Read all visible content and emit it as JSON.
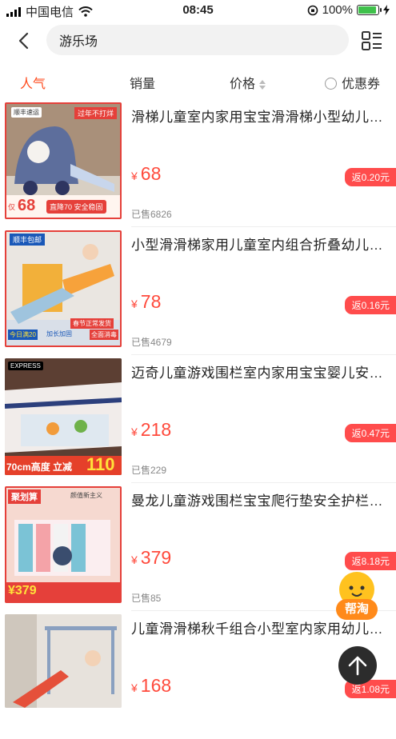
{
  "status_bar": {
    "carrier": "中国电信",
    "time": "08:45",
    "battery_percent": 100,
    "battery_label": "100%"
  },
  "search": {
    "query": "游乐场"
  },
  "sort_tabs": {
    "popular": "人气",
    "sales": "销量",
    "price": "价格",
    "coupon": "优惠券",
    "active": "popular"
  },
  "icons": {
    "back": "chevron-left-icon",
    "list_toggle": "list-grid-toggle-icon",
    "price_sort": "sort-arrows-icon",
    "back_to_top": "arrow-up-icon"
  },
  "colors": {
    "accent": "#ff4a1c",
    "price": "#ff4a3c",
    "rebate_badge": "#ff4c4c",
    "helper": "#ff8a1a"
  },
  "products": [
    {
      "title": "滑梯儿童室内家用宝宝滑滑梯小型幼儿园游乐场",
      "currency": "¥",
      "price": "68",
      "rebate": "返0.20元",
      "sold": "已售6826",
      "thumb_tags": [
        "过年不打烊",
        "顺丰速运",
        "仅",
        "68",
        "直降70 安全稳固"
      ]
    },
    {
      "title": "小型滑滑梯家用儿童室内组合折叠幼儿园游乐场",
      "currency": "¥",
      "price": "78",
      "rebate": "返0.16元",
      "sold": "已售4679",
      "thumb_tags": [
        "顺丰包邮",
        "春节正常发货",
        "今日满20",
        "加长加固",
        "全面消毒"
      ]
    },
    {
      "title": "迈奇儿童游戏围栏室内家用宝宝婴儿安全防护栏",
      "currency": "¥",
      "price": "218",
      "rebate": "返0.47元",
      "sold": "已售229",
      "thumb_tags": [
        "EXPRESS",
        "70cm高度 立减",
        "110"
      ]
    },
    {
      "title": "曼龙儿童游戏围栏宝宝爬行垫安全护栏室内家用",
      "currency": "¥",
      "price": "379",
      "rebate": "返8.18元",
      "sold": "已售85",
      "thumb_tags": [
        "聚划算",
        "颜值新主义",
        "¥379"
      ]
    },
    {
      "title": "儿童滑滑梯秋千组合小型室内家用幼儿园游乐场",
      "currency": "¥",
      "price": "168",
      "rebate": "返1.08元",
      "sold": "",
      "thumb_tags": []
    }
  ],
  "floating": {
    "helper_label": "帮淘"
  }
}
